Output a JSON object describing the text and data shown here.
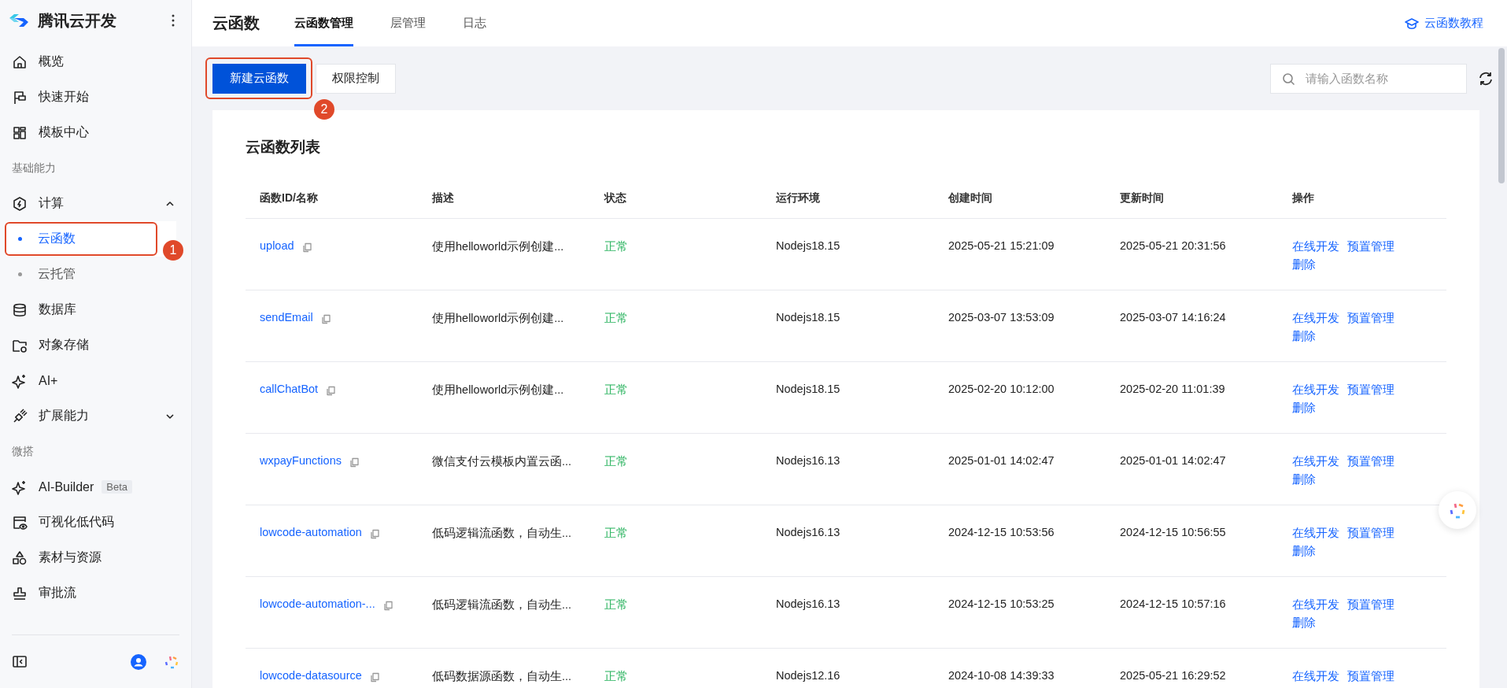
{
  "sidebar": {
    "brand": "腾讯云开发",
    "items": [
      {
        "kind": "item",
        "label": "概览",
        "selected": false
      },
      {
        "kind": "item",
        "label": "快速开始",
        "selected": false
      },
      {
        "kind": "item",
        "label": "模板中心",
        "selected": false
      },
      {
        "kind": "section",
        "label": "基础能力"
      },
      {
        "kind": "group",
        "label": "计算",
        "expanded": true,
        "children": [
          {
            "label": "云函数",
            "selected": true,
            "annotation": "1"
          },
          {
            "label": "云托管",
            "selected": false
          }
        ]
      },
      {
        "kind": "item",
        "label": "数据库",
        "selected": false
      },
      {
        "kind": "item",
        "label": "对象存储",
        "selected": false
      },
      {
        "kind": "item",
        "label": "AI+",
        "selected": false
      },
      {
        "kind": "group",
        "label": "扩展能力",
        "expanded": false
      },
      {
        "kind": "section",
        "label": "微搭"
      },
      {
        "kind": "item",
        "label": "AI-Builder",
        "tag": "Beta",
        "selected": false
      },
      {
        "kind": "item",
        "label": "可视化低代码",
        "selected": false
      },
      {
        "kind": "item",
        "label": "素材与资源",
        "selected": false
      },
      {
        "kind": "item",
        "label": "审批流",
        "selected": false
      }
    ]
  },
  "header": {
    "title": "云函数",
    "tabs": [
      {
        "label": "云函数管理",
        "selected": true
      },
      {
        "label": "层管理",
        "selected": false
      },
      {
        "label": "日志",
        "selected": false
      }
    ],
    "help_link": "云函数教程"
  },
  "toolbar": {
    "buttons": [
      {
        "label": "新建云函数",
        "kind": "primary",
        "annotation": "2"
      },
      {
        "label": "权限控制",
        "kind": "default"
      }
    ],
    "search": {
      "placeholder": "请输入函数名称"
    }
  },
  "table": {
    "title": "云函数列表",
    "columns": [
      "函数ID/名称",
      "描述",
      "状态",
      "运行环境",
      "创建时间",
      "更新时间",
      "操作"
    ],
    "rows": [
      {
        "name": "upload",
        "description": "使用helloworld示例创建...",
        "status": "正常",
        "runtime": "Nodejs18.15",
        "created": "2025-05-21 15:21:09",
        "updated": "2025-05-21 20:31:56",
        "actions": [
          "在线开发",
          "预置管理",
          "删除"
        ]
      },
      {
        "name": "sendEmail",
        "description": "使用helloworld示例创建...",
        "status": "正常",
        "runtime": "Nodejs18.15",
        "created": "2025-03-07 13:53:09",
        "updated": "2025-03-07 14:16:24",
        "actions": [
          "在线开发",
          "预置管理",
          "删除"
        ]
      },
      {
        "name": "callChatBot",
        "description": "使用helloworld示例创建...",
        "status": "正常",
        "runtime": "Nodejs18.15",
        "created": "2025-02-20 10:12:00",
        "updated": "2025-02-20 11:01:39",
        "actions": [
          "在线开发",
          "预置管理",
          "删除"
        ]
      },
      {
        "name": "wxpayFunctions",
        "description": "微信支付云模板内置云函...",
        "status": "正常",
        "runtime": "Nodejs16.13",
        "created": "2025-01-01 14:02:47",
        "updated": "2025-01-01 14:02:47",
        "actions": [
          "在线开发",
          "预置管理",
          "删除"
        ]
      },
      {
        "name": "lowcode-automation",
        "description": "低码逻辑流函数，自动生...",
        "status": "正常",
        "runtime": "Nodejs16.13",
        "created": "2024-12-15 10:53:56",
        "updated": "2024-12-15 10:56:55",
        "actions": [
          "在线开发",
          "预置管理",
          "删除"
        ]
      },
      {
        "name": "lowcode-automation-...",
        "description": "低码逻辑流函数，自动生...",
        "status": "正常",
        "runtime": "Nodejs16.13",
        "created": "2024-12-15 10:53:25",
        "updated": "2024-12-15 10:57:16",
        "actions": [
          "在线开发",
          "预置管理",
          "删除"
        ]
      },
      {
        "name": "lowcode-datasource",
        "description": "低码数据源函数，自动生...",
        "status": "正常",
        "runtime": "Nodejs12.16",
        "created": "2024-10-08 14:39:33",
        "updated": "2025-05-21 16:29:52",
        "actions": [
          "在线开发",
          "预置管理"
        ]
      }
    ]
  }
}
